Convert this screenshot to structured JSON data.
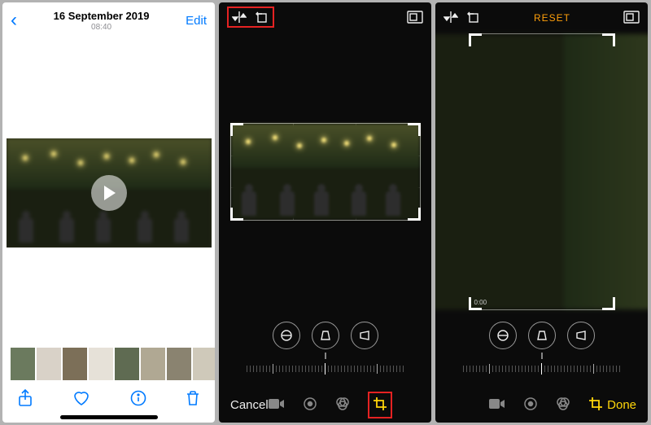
{
  "phone1": {
    "date": "16 September 2019",
    "time": "08:40",
    "edit": "Edit"
  },
  "editor": {
    "cancel": "Cancel",
    "done": "Done",
    "reset": "RESET",
    "timestamp": "0:00"
  }
}
